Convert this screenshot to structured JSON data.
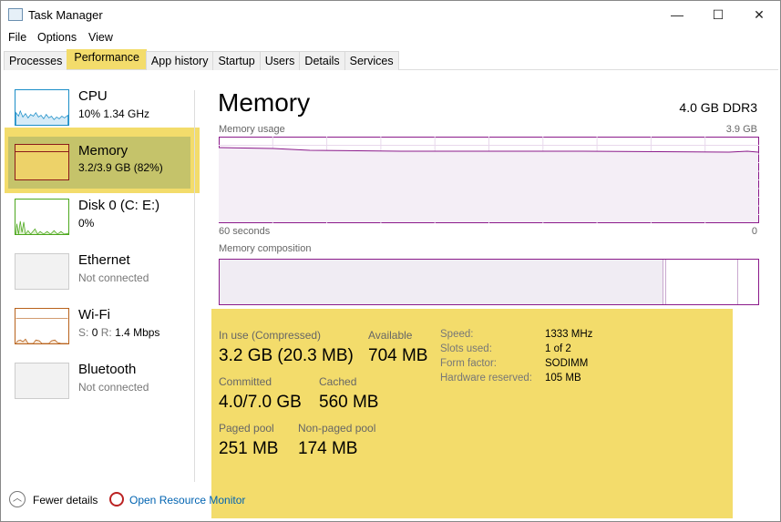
{
  "window": {
    "title": "Task Manager",
    "controls": [
      "—",
      "☐",
      "✕"
    ]
  },
  "menu": [
    "File",
    "Options",
    "View"
  ],
  "tabs": [
    "Processes",
    "Performance",
    "App history",
    "Startup",
    "Users",
    "Details",
    "Services"
  ],
  "selected_tab": "Performance",
  "sidebar": [
    {
      "name": "CPU",
      "sub": "10% 1.34 GHz",
      "color": "#1b8ec8"
    },
    {
      "name": "Memory",
      "sub": "3.2/3.9 GB (82%)",
      "color": "#8b1a4a",
      "selected": true
    },
    {
      "name": "Disk 0 (C: E:)",
      "sub": "0%",
      "color": "#4da81e"
    },
    {
      "name": "Ethernet",
      "sub": "Not connected"
    },
    {
      "name": "Wi-Fi",
      "sub_s": "S:",
      "sub_s_val": "0",
      "sub_r": "R:",
      "sub_r_val": "1.4 Mbps",
      "color": "#b8621b"
    },
    {
      "name": "Bluetooth",
      "sub": "Not connected"
    }
  ],
  "main": {
    "title": "Memory",
    "spec": "4.0 GB DDR3",
    "usage_label": "Memory usage",
    "usage_max": "3.9 GB",
    "time_left": "60 seconds",
    "time_right": "0",
    "composition_label": "Memory composition",
    "stats": {
      "in_use_label": "In use (Compressed)",
      "in_use": "3.2 GB (20.3 MB)",
      "available_label": "Available",
      "available": "704 MB",
      "committed_label": "Committed",
      "committed": "4.0/7.0 GB",
      "cached_label": "Cached",
      "cached": "560 MB",
      "paged_label": "Paged pool",
      "paged": "251 MB",
      "nonpaged_label": "Non-paged pool",
      "nonpaged": "174 MB"
    },
    "details": [
      {
        "k": "Speed:",
        "v": "1333 MHz"
      },
      {
        "k": "Slots used:",
        "v": "1 of 2"
      },
      {
        "k": "Form factor:",
        "v": "SODIMM"
      },
      {
        "k": "Hardware reserved:",
        "v": "105 MB"
      }
    ]
  },
  "footer": {
    "fewer": "Fewer details",
    "monitor": "Open Resource Monitor"
  },
  "colors": {
    "highlight": "#f3dc6b",
    "memory": "#8b1a8b",
    "link": "#0063b1"
  }
}
